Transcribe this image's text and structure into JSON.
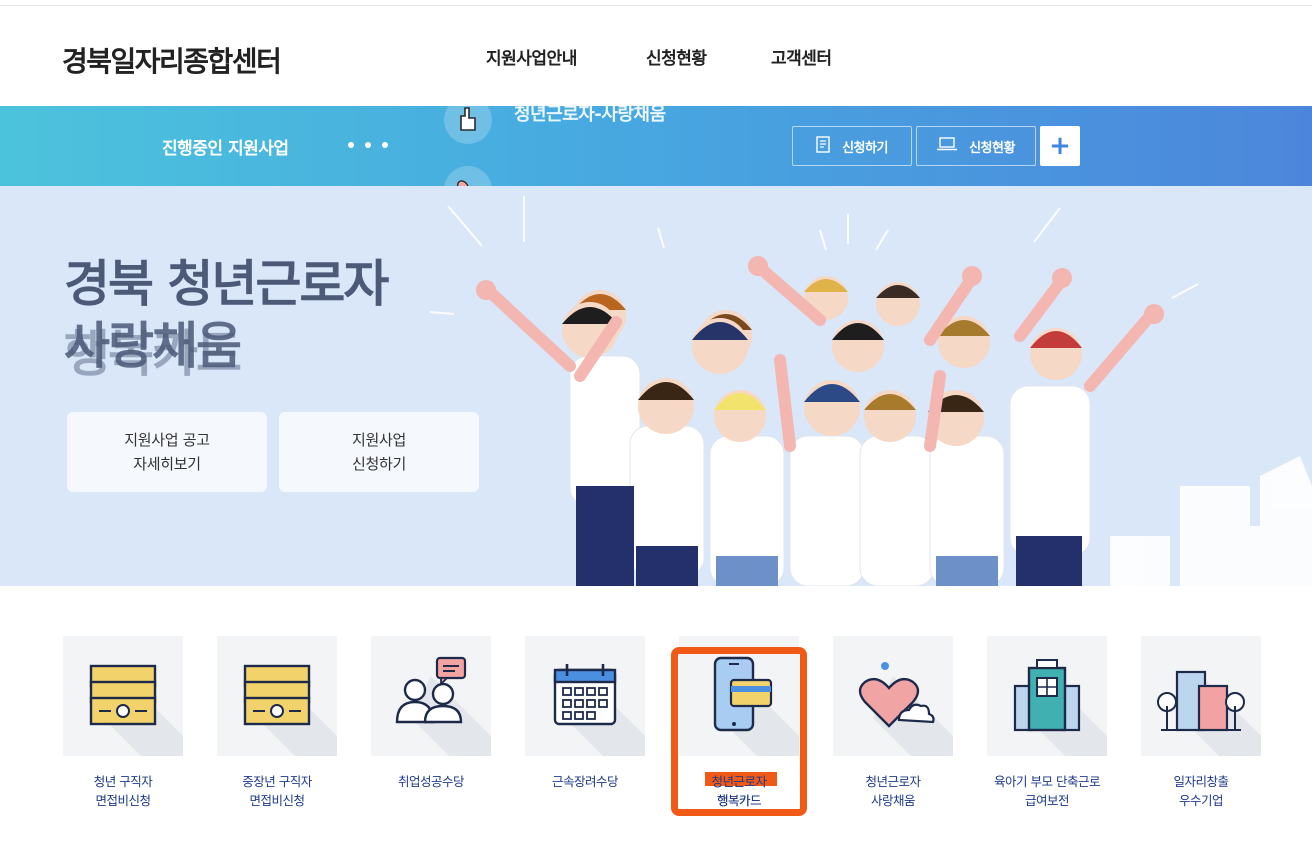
{
  "header": {
    "logo": "경북일자리종합센터",
    "nav": [
      {
        "label": "지원사업안내"
      },
      {
        "label": "신청현황"
      },
      {
        "label": "고객센터"
      }
    ]
  },
  "bar": {
    "title": "진행중인 지원사업",
    "rolling_text": "청년근로자-사랑채움",
    "apply_button": "신청하기",
    "status_button": "신청현황",
    "plus_button": "+"
  },
  "hero": {
    "title": "경북 청년근로자",
    "subtitle": "사랑채움",
    "subtitle_ghost": "행복카드",
    "buttons": [
      {
        "label": "지원사업 공고\n자세히보기"
      },
      {
        "label": "지원사업\n신청하기"
      }
    ]
  },
  "services": [
    {
      "label": "청년 구직자\n면접비신청",
      "icon": "money-stack-icon"
    },
    {
      "label": "중장년 구직자\n면접비신청",
      "icon": "money-stack-icon"
    },
    {
      "label": "취업성공수당",
      "icon": "people-chat-icon"
    },
    {
      "label": "근속장려수당",
      "icon": "calendar-icon"
    },
    {
      "label": "청년근로자\n행복카드",
      "icon": "phone-card-icon"
    },
    {
      "label": "청년근로자\n사랑채움",
      "icon": "heart-cloud-icon"
    },
    {
      "label": "육아기 부모 단축근로\n급여보전",
      "icon": "building-icon"
    },
    {
      "label": "일자리창출\n우수기업",
      "icon": "city-trees-icon"
    }
  ],
  "colors": {
    "bar_gradient_start": "#4cc3dc",
    "bar_gradient_end": "#4c86dc",
    "hero_bg": "#d9e7f8",
    "highlight": "#f15a16",
    "service_label": "#1e3a8a"
  }
}
